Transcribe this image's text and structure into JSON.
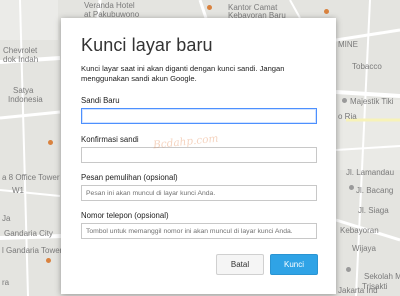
{
  "map": {
    "labels": [
      {
        "text": "Veranda Hotel",
        "cls": ""
      },
      {
        "text": "at Pakubuwono",
        "cls": ""
      },
      {
        "text": "Kantor Camat",
        "cls": ""
      },
      {
        "text": "Kebayoran Baru",
        "cls": ""
      },
      {
        "text": "Chevrolet",
        "cls": ""
      },
      {
        "text": "dok Indah",
        "cls": ""
      },
      {
        "text": "Satya",
        "cls": ""
      },
      {
        "text": "Indonesia",
        "cls": ""
      },
      {
        "text": "Majestik Tiki",
        "cls": ""
      },
      {
        "text": "MINE",
        "cls": ""
      },
      {
        "text": "Tobacco",
        "cls": ""
      },
      {
        "text": "o Ria",
        "cls": ""
      },
      {
        "text": "Jl. Lamandau",
        "cls": ""
      },
      {
        "text": "Jl. Bacang",
        "cls": ""
      },
      {
        "text": "Jl. Siaga",
        "cls": ""
      },
      {
        "text": "Wijaya",
        "cls": ""
      },
      {
        "text": "Sekolah M",
        "cls": ""
      },
      {
        "text": "Trisakti",
        "cls": ""
      },
      {
        "text": "Kebayoran",
        "cls": ""
      },
      {
        "text": "a 8 Office Tower",
        "cls": ""
      },
      {
        "text": "Gandaria City",
        "cls": ""
      },
      {
        "text": "l Gandaria Tower",
        "cls": ""
      },
      {
        "text": "ra",
        "cls": ""
      },
      {
        "text": "Jakarta Ind",
        "cls": ""
      },
      {
        "text": "Ja",
        "cls": ""
      },
      {
        "text": "W1",
        "cls": ""
      }
    ]
  },
  "dialog": {
    "title": "Kunci layar baru",
    "description": "Kunci layar saat ini akan diganti dengan kunci sandi. Jangan menggunakan sandi akun Google.",
    "fields": {
      "new_password": {
        "label": "Sandi Baru",
        "value": "",
        "placeholder": ""
      },
      "confirm_password": {
        "label": "Konfirmasi sandi",
        "value": "",
        "placeholder": ""
      },
      "recovery_message": {
        "label": "Pesan pemulihan (opsional)",
        "value": "",
        "placeholder": "Pesan ini akan muncul di layar kunci Anda."
      },
      "phone_number": {
        "label": "Nomor telepon (opsional)",
        "value": "",
        "placeholder": "Tombol untuk memanggil nomor ini akan muncul di layar kunci Anda."
      }
    },
    "buttons": {
      "cancel": "Batal",
      "ok": "Kunci"
    },
    "watermark": "Bcdahp.com"
  },
  "colors": {
    "accent": "#2fa3e6",
    "focus_border": "#4d90fe",
    "map_background": "#e3e3df"
  }
}
